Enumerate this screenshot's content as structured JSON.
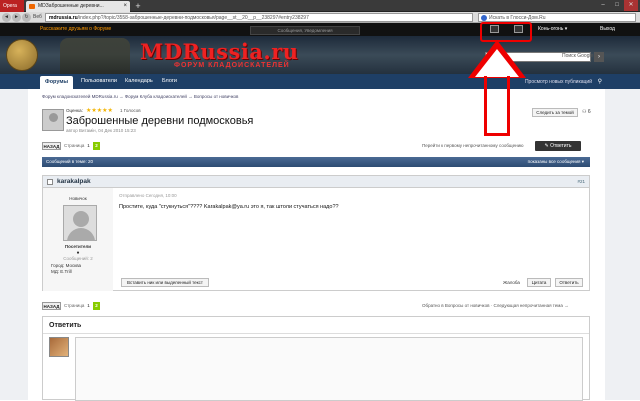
{
  "browser": {
    "app_button": "Opera",
    "tab_title": "MDЗаброшенные деревни...",
    "new_tab": "+",
    "win_min": "–",
    "win_max": "□",
    "win_close": "✕",
    "back": "◄",
    "forward": "►",
    "reload": "↻",
    "home": "⌂",
    "web_label": "Веб",
    "url_host": "mdrussia.ru",
    "url_path": "/index.php?/topic/3558-заброшенные-деревни-подмосковья/page__st__20__p__238297#entry238297",
    "search_placeholder": "Искать в Глосси-Дом.Ru"
  },
  "sitebar": {
    "welcome_link": "Расскажите друзьям о Форуме",
    "user_name": "Конь-огонь ▾",
    "logout": "Выход",
    "tooltip": "Сообщения, Уведомления"
  },
  "banner": {
    "logo": "MDRussia.ru",
    "subtitle": "ФОРУМ КЛАДОИСКАТЕЛЕЙ",
    "search_placeholder": "Искать...",
    "search_scope": "Поиск Google",
    "search_go": "›"
  },
  "nav": {
    "tabs": [
      "Форумы",
      "Пользователи",
      "Календарь",
      "Блоги"
    ],
    "new_content": "Просмотр новых публикаций",
    "pin": "⚲"
  },
  "breadcrumb": "Форум кладоискателей MDRussia.ru  →  Форум Клуба кладоискателей  →  Вопросы от новичков",
  "topic": {
    "rating_label": "Оценка:",
    "stars": "★★★★★",
    "votes": "1 Голосов",
    "title": "Заброшенные деревни подмосковья",
    "meta": "автор Витамін, 04 Дек 2010 15:23",
    "follow": "Следить за темой",
    "follow_count": "⚇ 6"
  },
  "pager": {
    "back": "НАЗАД",
    "label": "Страница",
    "pages": [
      "1",
      "2"
    ],
    "current_index": 1,
    "first_unread": "Перейти к первому непрочитанному сообщению",
    "reply": "✎ Ответить",
    "bottom_nav": "Обратно в Вопросы от новичков · Следующая непрочитанная тема →"
  },
  "thread_head": {
    "count": "Сообщений в теме: 20",
    "filter": "показаны все сообщения  ▾"
  },
  "post": {
    "author": "karakalpak",
    "number": "#21",
    "rank": "Новичок",
    "group": "Посетители",
    "pips": "●",
    "msgs": "Сообщений: 2",
    "city_label": "Город: Москва",
    "md_label": "МД: E.Trill",
    "posted": "Отправлено Сегодня, 10:00",
    "text": "Простите, куда \"стукнуться\"???? Karakalpak@ya.ru это я, так штоли стучаться надо??",
    "multiquote": "Вставить ник или выделенный текст",
    "report": "Жалоба",
    "quote": "Цитата",
    "answer": "Ответить"
  },
  "reply_box": {
    "title": "Ответить"
  },
  "colors": {
    "annotation": "#e00000",
    "nav_bg": "#1e3f66",
    "logo_red": "#e22222",
    "page_current": "#88cc00"
  }
}
